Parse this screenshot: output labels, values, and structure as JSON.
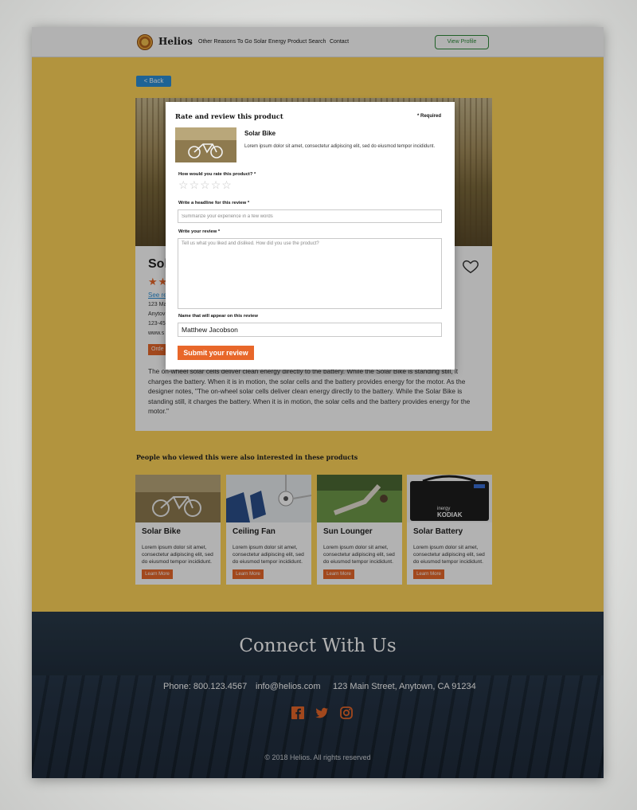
{
  "header": {
    "brand": "Helios",
    "nav": [
      "Other Reasons To Go Solar",
      "Energy Product Search",
      "Contact"
    ],
    "view_profile": "View Profile"
  },
  "main": {
    "back_label": "< Back",
    "product": {
      "title": "Sol",
      "stars": "★★",
      "link": "See re",
      "lines": [
        "123 Ma",
        "Anytov",
        "123-45",
        "www.s"
      ],
      "order_label": "Orde",
      "description": "The on-wheel solar cells deliver clean energy directly to the battery. While the Solar Bike is standing still, it charges the battery. When it is in motion, the solar cells and the battery provides energy for the motor. As the designer notes, \"The on-wheel solar cells deliver clean energy directly to the battery. While the Solar Bike is standing still, it charges the battery. When it is in motion, the solar cells and the battery provides energy for the motor.\""
    },
    "related_heading": "People who viewed this were also interested in these products",
    "related": [
      {
        "title": "Solar Bike",
        "text": "Lorem ipsum dolor sit amet, consectetur adipiscing elit, sed do eiusmod tempor incididunt.",
        "button": "Learn More"
      },
      {
        "title": "Ceiling Fan",
        "text": "Lorem ipsum dolor sit amet, consectetur adipiscing elit, sed do eiusmod tempor incididunt.",
        "button": "Learn More"
      },
      {
        "title": "Sun Lounger",
        "text": "Lorem ipsum dolor sit amet, consectetur adipiscing elit, sed do eiusmod tempor incididunt.",
        "button": "Learn More"
      },
      {
        "title": "Solar Battery",
        "text": "Lorem ipsum dolor sit amet, consectetur adipiscing elit, sed do eiusmod tempor incididunt.",
        "button": "Learn More"
      }
    ],
    "battery_brand": "inergy",
    "battery_model": "KODIAK"
  },
  "footer": {
    "title": "Connect With Us",
    "phone": "Phone: 800.123.4567",
    "email": "info@helios.com",
    "address": "123 Main Street, Anytown, CA 91234",
    "copyright": "© 2018 Helios. All rights reserved"
  },
  "modal": {
    "title": "Rate and review this product",
    "required_note": "* Required",
    "product_name": "Solar Bike",
    "product_desc": "Lorem ipsum dolor sit amet, consectetur adipiscing elit, sed do eiusmod tempor incididunt.",
    "rating_label": "How would you rate this product? *",
    "rating_value": 0,
    "rating_max": 5,
    "headline_label": "Write a headline for this review *",
    "headline_placeholder": "Summarize your experience in a few words",
    "review_label": "Write your review *",
    "review_placeholder": "Tell us what you liked and disliked. How did you use the product?",
    "name_label": "Name that will appear on this review",
    "name_value": "Matthew Jacobson",
    "submit_label": "Submit your review"
  },
  "colors": {
    "accent_orange": "#e8672a",
    "link_blue": "#2b8fd6",
    "brand_green": "#2e8b3a",
    "page_yellow": "#ffd45a"
  }
}
